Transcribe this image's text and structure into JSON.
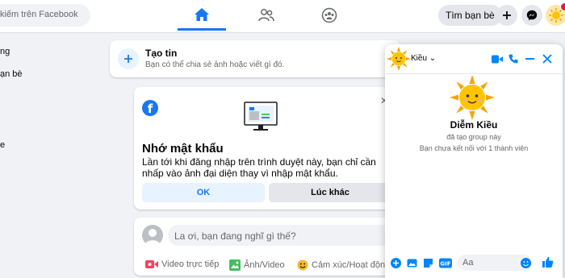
{
  "topbar": {
    "search_placeholder": "kiếm trên Facebook",
    "find_friends_label": "Tìm bạn bè",
    "icons": [
      "home-icon",
      "friends-icon",
      "groups-icon",
      "plus-icon",
      "messenger-icon",
      "avatar-sun"
    ]
  },
  "sidebar": {
    "items": [
      {
        "label": "ng"
      },
      {
        "label": "ạn bè"
      },
      {
        "label": "e"
      }
    ]
  },
  "story": {
    "title": "Tạo tin",
    "subtitle": "Bạn có thể chia sẻ ảnh hoặc viết gì đó."
  },
  "password_card": {
    "title": "Nhớ mật khẩu",
    "body": "Lần tới khi đăng nhập trên trình duyệt này, bạn chỉ cần nhấp vào ảnh đại diện thay vì nhập mật khẩu.",
    "ok_label": "OK",
    "later_label": "Lúc khác"
  },
  "post": {
    "placeholder": "La ơi, bạn đang nghĩ gì thế?",
    "actions": [
      {
        "label": "Video trực tiếp",
        "color": "#f3425f"
      },
      {
        "label": "Ảnh/Video",
        "color": "#45bd62"
      },
      {
        "label": "Cảm xúc/Hoạt động",
        "color": "#f7b928"
      }
    ]
  },
  "chat": {
    "header_name": "Kiều",
    "contact_name": "Diễm Kiều",
    "line1": "đã tạo group này",
    "line2": "Bạn chưa kết nối với 1 thành viên",
    "input_placeholder": "Aa",
    "accent": "#0084ff"
  },
  "colors": {
    "brand": "#1877f2",
    "background": "#f0f2f5"
  }
}
